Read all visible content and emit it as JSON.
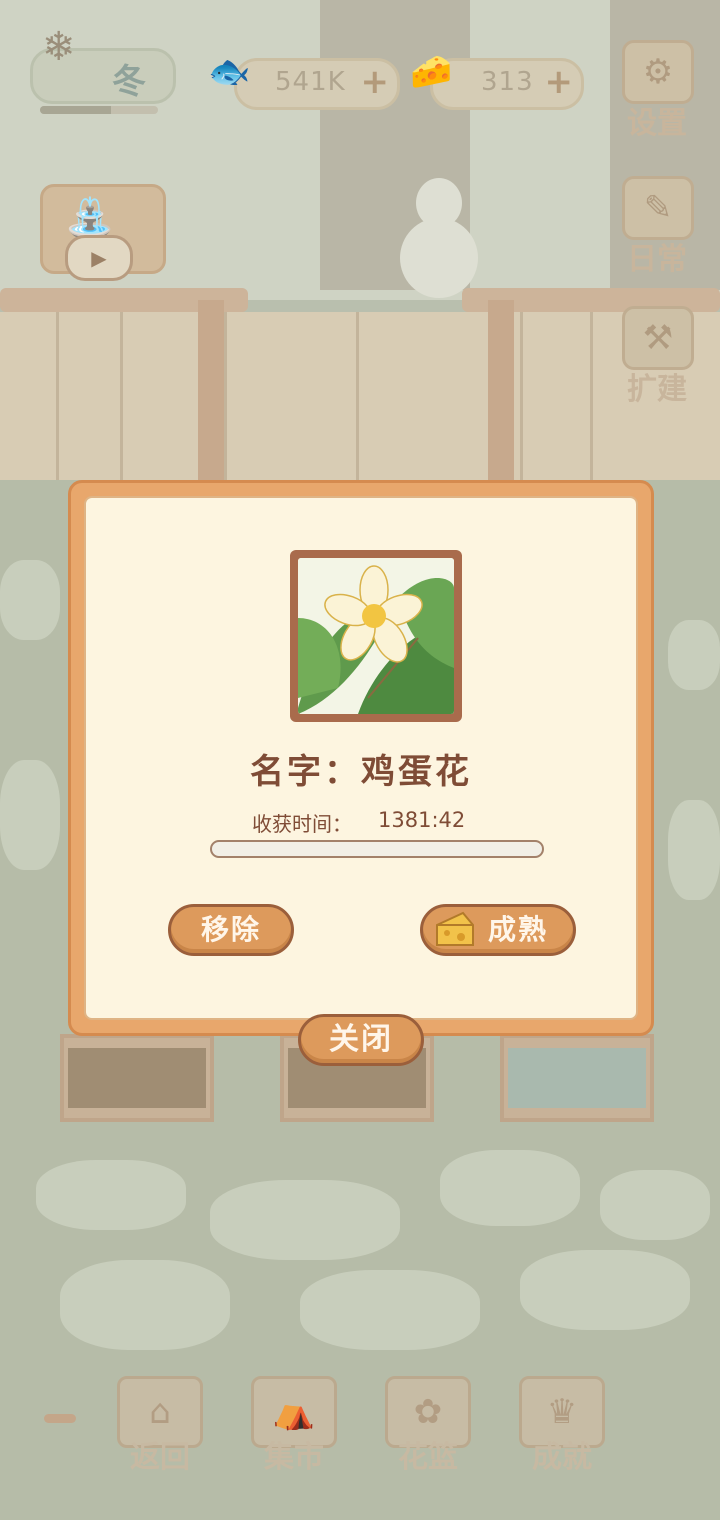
{
  "hud": {
    "season_label": "冬",
    "season_progress": 0.6,
    "fish_amount": "541K",
    "cheese_amount": "313",
    "plus_glyph": "+"
  },
  "side_menu": {
    "settings_label": "设置",
    "daily_label": "日常",
    "expand_label": "扩建"
  },
  "dialog": {
    "name_text": "名字：鸡蛋花",
    "harvest_label": "收获时间：",
    "harvest_time": "1381:42",
    "harvest_progress": 0.0,
    "remove_label": "移除",
    "mature_label": "成熟",
    "close_label": "关闭"
  },
  "bottom_nav": {
    "back_label": "返回",
    "market_label": "集市",
    "basket_label": "花篮",
    "achievement_label": "成就"
  },
  "colors": {
    "dialog_border": "#e8a76c",
    "dialog_bg": "#fdf5e0",
    "button": "#dd9a5c",
    "text_brown": "#7f4c36"
  }
}
